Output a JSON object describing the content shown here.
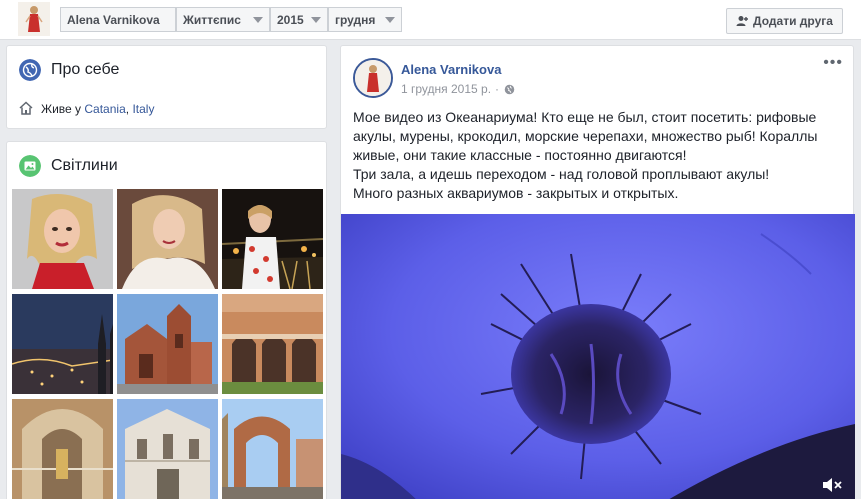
{
  "topbar": {
    "name": "Alena Varnikova",
    "section": "Життєпис",
    "year": "2015",
    "month": "грудня",
    "add_friend": "Додати друга",
    "add_friend_icon": "add-person-icon"
  },
  "about": {
    "title": "Про себе",
    "icon": "globe-icon",
    "lives_prefix": "Живе у",
    "city": "Catania",
    "separator": ",",
    "country": "Italy",
    "home_icon": "home-icon"
  },
  "photos": {
    "title": "Світлини",
    "icon": "photo-icon"
  },
  "post": {
    "author": "Alena Varnikova",
    "date": "1 грудня 2015 р.",
    "separator": "·",
    "privacy_icon": "globe-icon",
    "more": "•••",
    "lines": [
      "Мое видео из Океанариума! Кто еще не был, стоит посетить: рифовые",
      "акулы, мурены, крокодил, морские черепахи, множество рыб! Кораллы",
      "живые, они такие классные - постоянно двигаются!",
      "Три зала, а идешь переходом - над головой проплывают акулы!",
      "Много разных аквариумов - закрытых и открытых."
    ],
    "mute_icon": "muted-speaker-icon"
  },
  "colors": {
    "link": "#365899",
    "accent": "#3b5998",
    "muted_text": "#90949c",
    "video_blue": "#5c5fe8"
  }
}
